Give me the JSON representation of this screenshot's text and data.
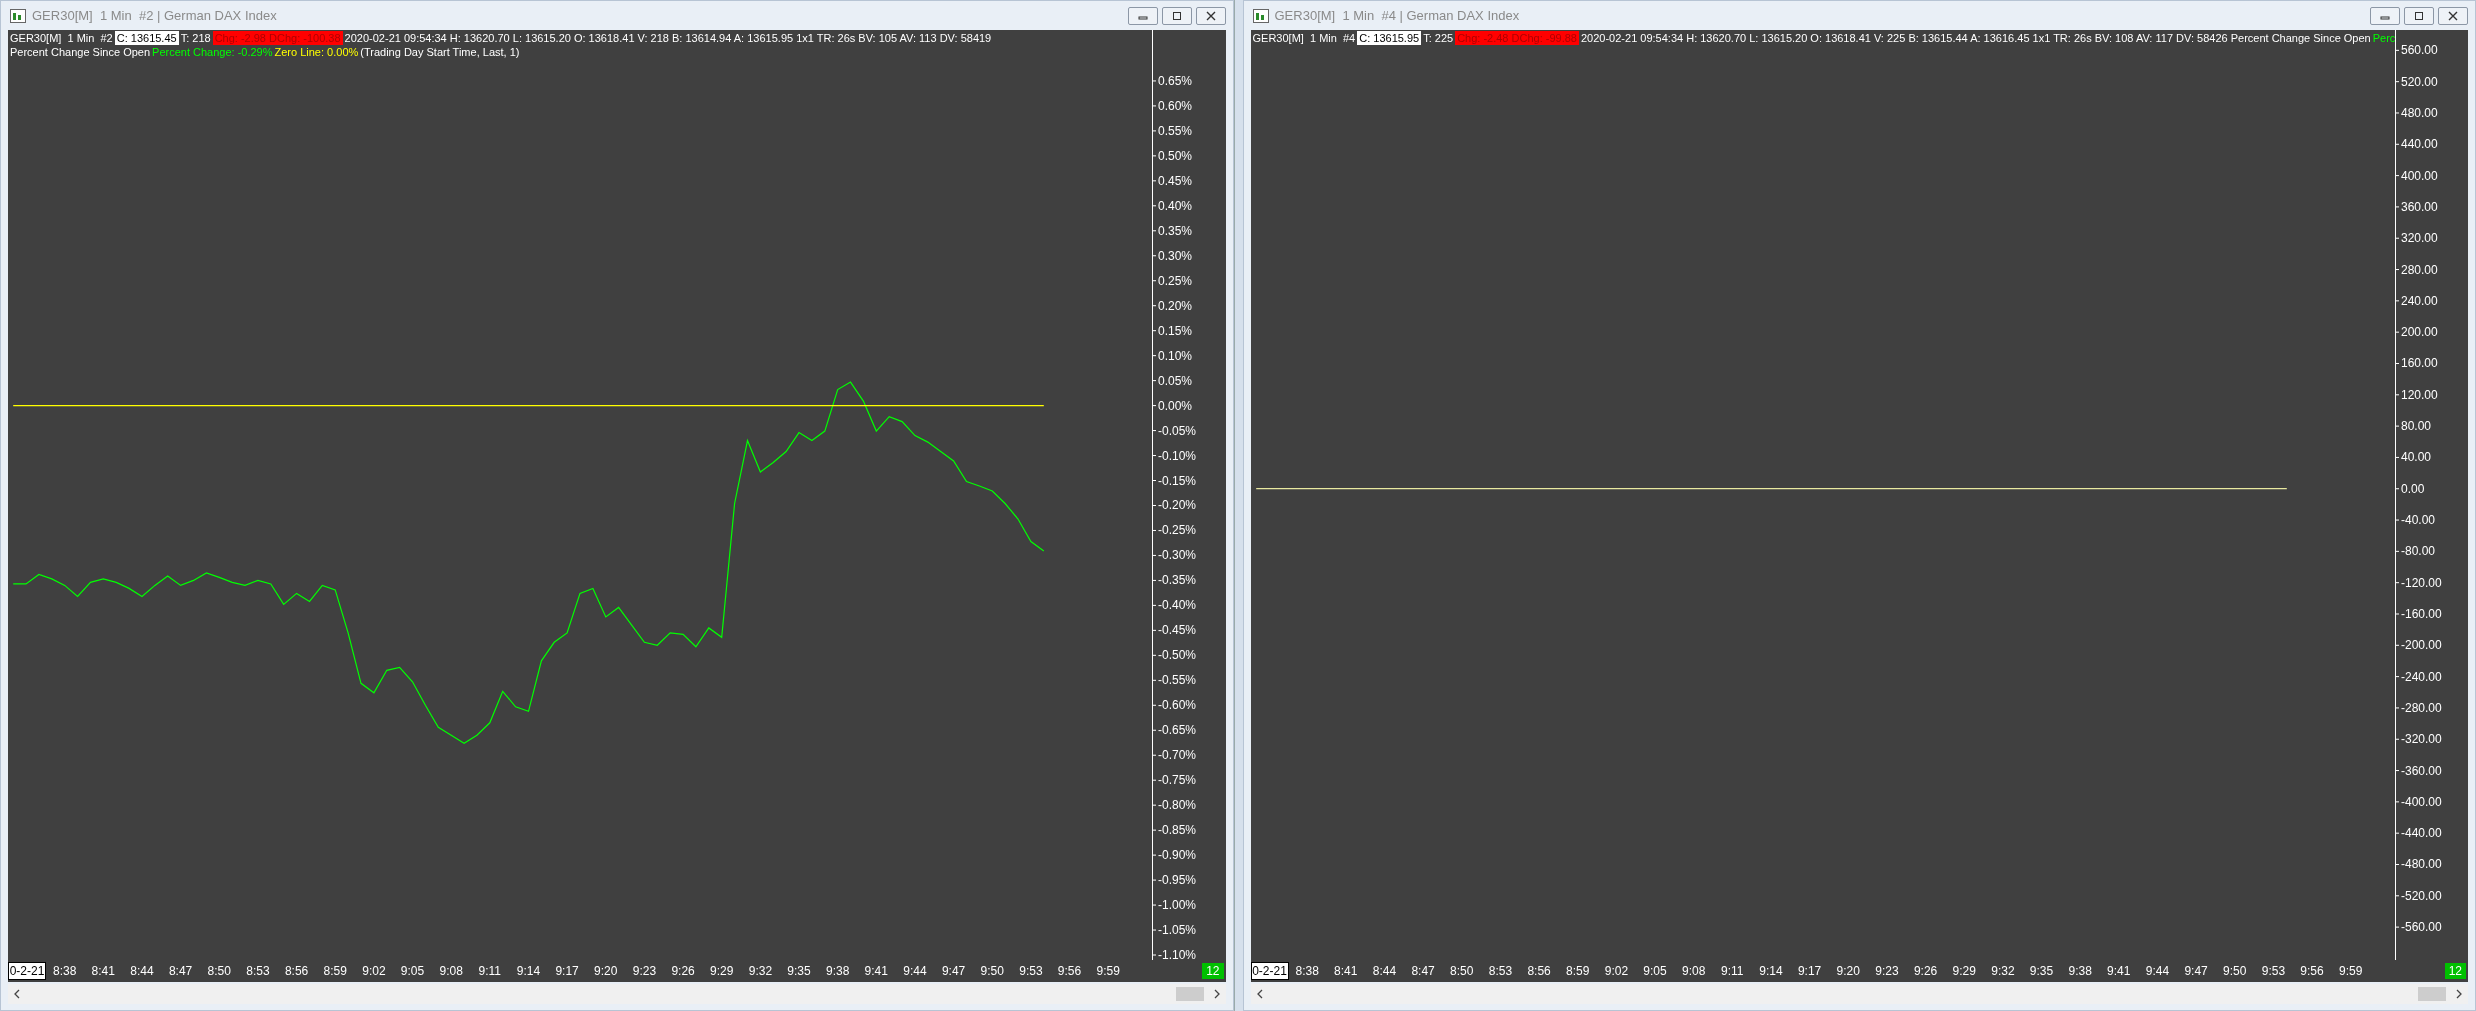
{
  "windows": [
    {
      "title": "GER30[M]  1 Min  #2 | German DAX Index",
      "header_lines": [
        [
          {
            "kind": "text",
            "text": "GER30[M]  1 Min  #2"
          },
          {
            "kind": "boxed",
            "text": "C: 13615.45"
          },
          {
            "kind": "text",
            "text": "T: 218"
          },
          {
            "kind": "alert",
            "text": "Chg: -2.98 DChg: -100.38"
          },
          {
            "kind": "text",
            "text": "2020-02-21 09:54:34 H: 13620.70 L: 13615.20 O: 13618.41 V: 218 B: 13614.94 A: 13615.95 1x1 TR: 26s BV: 105 AV: 113 DV: 58419"
          }
        ],
        [
          {
            "kind": "text",
            "text": "Percent Change Since Open",
            "color": "#ffffff"
          },
          {
            "kind": "text",
            "text": "Percent Change: -0.29%",
            "color": "#00ff00"
          },
          {
            "kind": "text",
            "text": "Zero Line: 0.00%",
            "color": "#ffff00"
          },
          {
            "kind": "text",
            "text": "(Trading Day Start Time, Last, 1)",
            "color": "#ffffff"
          }
        ]
      ],
      "chart_data": {
        "type": "line",
        "categories": [
          null,
          null,
          null,
          null,
          "8:38",
          null,
          null,
          "8:41",
          null,
          null,
          "8:44",
          null,
          null,
          "8:47",
          null,
          null,
          "8:50",
          null,
          null,
          "8:53",
          null,
          null,
          "8:56",
          null,
          null,
          "8:59",
          null,
          null,
          "9:02",
          null,
          null,
          "9:05",
          null,
          null,
          "9:08",
          null,
          null,
          "9:11",
          null,
          null,
          "9:14",
          null,
          null,
          "9:17",
          null,
          null,
          "9:20",
          null,
          null,
          "9:23",
          null,
          null,
          "9:26",
          null,
          null,
          "9:29",
          null,
          null,
          "9:32",
          null,
          null,
          "9:35",
          null,
          null,
          "9:38",
          null,
          null,
          "9:41",
          null,
          null,
          "9:44",
          null,
          null,
          "9:47",
          null,
          null,
          "9:50",
          null,
          null,
          "9:53",
          null,
          null,
          "9:56",
          null,
          null,
          "9:59"
        ],
        "series": [
          {
            "color": "#00ff00",
            "values": [
              -0.357,
              -0.357,
              -0.338,
              -0.347,
              -0.36,
              -0.382,
              -0.354,
              -0.347,
              -0.354,
              -0.366,
              -0.382,
              -0.36,
              -0.341,
              -0.36,
              -0.35,
              -0.335,
              -0.344,
              -0.354,
              -0.36,
              -0.35,
              -0.357,
              -0.398,
              -0.376,
              -0.392,
              -0.36,
              -0.369,
              -0.455,
              -0.556,
              -0.575,
              -0.53,
              -0.524,
              -0.553,
              -0.6,
              -0.644,
              -0.66,
              -0.676,
              -0.66,
              -0.635,
              -0.572,
              -0.603,
              -0.612,
              -0.511,
              -0.474,
              -0.455,
              -0.376,
              -0.366,
              -0.423,
              -0.404,
              -0.439,
              -0.474,
              -0.48,
              -0.455,
              -0.458,
              -0.483,
              -0.445,
              -0.464,
              -0.196,
              -0.07,
              -0.133,
              -0.114,
              -0.092,
              -0.054,
              -0.07,
              -0.051,
              0.032,
              0.047,
              0.009,
              -0.051,
              -0.022,
              -0.032,
              -0.06,
              -0.073,
              -0.092,
              -0.111,
              -0.152,
              -0.161,
              -0.171,
              -0.196,
              -0.227,
              -0.272,
              -0.291,
              null,
              null,
              null,
              null,
              null
            ]
          },
          {
            "color": "#ffff00",
            "values": [
              0,
              0,
              0,
              0,
              0,
              0,
              0,
              0,
              0,
              0,
              0,
              0,
              0,
              0,
              0,
              0,
              0,
              0,
              0,
              0,
              0,
              0,
              0,
              0,
              0,
              0,
              0,
              0,
              0,
              0,
              0,
              0,
              0,
              0,
              0,
              0,
              0,
              0,
              0,
              0,
              0,
              0,
              0,
              0,
              0,
              0,
              0,
              0,
              0,
              0,
              0,
              0,
              0,
              0,
              0,
              0,
              0,
              0,
              0,
              0,
              0,
              0,
              0,
              0,
              0,
              0,
              0,
              0,
              0,
              0,
              0,
              0,
              0,
              0,
              0,
              0,
              0,
              0,
              0,
              0,
              0,
              null,
              null,
              null,
              null,
              null
            ]
          }
        ],
        "ylim": [
          -1.11,
          0.752
        ],
        "yticks": [
          {
            "value": 0.65,
            "label": "0.65%"
          },
          {
            "value": 0.6,
            "label": "0.60%"
          },
          {
            "value": 0.55,
            "label": "0.55%"
          },
          {
            "value": 0.5,
            "label": "0.50%"
          },
          {
            "value": 0.45,
            "label": "0.45%"
          },
          {
            "value": 0.4,
            "label": "0.40%"
          },
          {
            "value": 0.35,
            "label": "0.35%"
          },
          {
            "value": 0.3,
            "label": "0.30%"
          },
          {
            "value": 0.25,
            "label": "0.25%"
          },
          {
            "value": 0.2,
            "label": "0.20%"
          },
          {
            "value": 0.15,
            "label": "0.15%"
          },
          {
            "value": 0.1,
            "label": "0.10%"
          },
          {
            "value": 0.05,
            "label": "0.05%"
          },
          {
            "value": 0,
            "label": "0.00%"
          },
          {
            "value": -0.05,
            "label": "-0.05%"
          },
          {
            "value": -0.1,
            "label": "-0.10%"
          },
          {
            "value": -0.15,
            "label": "-0.15%"
          },
          {
            "value": -0.2,
            "label": "-0.20%"
          },
          {
            "value": -0.25,
            "label": "-0.25%"
          },
          {
            "value": -0.3,
            "label": "-0.30%"
          },
          {
            "value": -0.35,
            "label": "-0.35%"
          },
          {
            "value": -0.4,
            "label": "-0.40%"
          },
          {
            "value": -0.45,
            "label": "-0.45%"
          },
          {
            "value": -0.5,
            "label": "-0.50%"
          },
          {
            "value": -0.55,
            "label": "-0.55%"
          },
          {
            "value": -0.6,
            "label": "-0.60%"
          },
          {
            "value": -0.65,
            "label": "-0.65%"
          },
          {
            "value": -0.7,
            "label": "-0.70%"
          },
          {
            "value": -0.75,
            "label": "-0.75%"
          },
          {
            "value": -0.8,
            "label": "-0.80%"
          },
          {
            "value": -0.85,
            "label": "-0.85%"
          },
          {
            "value": -0.9,
            "label": "-0.90%"
          },
          {
            "value": -0.95,
            "label": "-0.95%"
          },
          {
            "value": -1.0,
            "label": "-1.00%"
          },
          {
            "value": -1.05,
            "label": "-1.05%"
          },
          {
            "value": -1.1,
            "label": "-1.10%"
          }
        ]
      },
      "date_label": "0-2-21",
      "bar_count": "12"
    },
    {
      "title": "GER30[M]  1 Min  #4 | German DAX Index",
      "header_lines": [
        [
          {
            "kind": "text",
            "text": "GER30[M]  1 Min  #4"
          },
          {
            "kind": "boxed",
            "text": "C: 13615.95"
          },
          {
            "kind": "text",
            "text": "T: 225"
          },
          {
            "kind": "alert",
            "text": "Chg: -2.48 DChg: -99.88"
          },
          {
            "kind": "text",
            "text": "2020-02-21 09:54:34 H: 13620.70 L: 13615.20 O: 13618.41 V: 225 B: 13615.44 A: 13616.45 1x1 TR: 26s BV: 108 AV: 117 DV: 58426 Percent Change Since Open"
          },
          {
            "kind": "text",
            "text": "Perc",
            "color": "#00ff00"
          }
        ]
      ],
      "chart_data": {
        "type": "line",
        "categories": [
          null,
          null,
          null,
          null,
          "8:38",
          null,
          null,
          "8:41",
          null,
          null,
          "8:44",
          null,
          null,
          "8:47",
          null,
          null,
          "8:50",
          null,
          null,
          "8:53",
          null,
          null,
          "8:56",
          null,
          null,
          "8:59",
          null,
          null,
          "9:02",
          null,
          null,
          "9:05",
          null,
          null,
          "9:08",
          null,
          null,
          "9:11",
          null,
          null,
          "9:14",
          null,
          null,
          "9:17",
          null,
          null,
          "9:20",
          null,
          null,
          "9:23",
          null,
          null,
          "9:26",
          null,
          null,
          "9:29",
          null,
          null,
          "9:32",
          null,
          null,
          "9:35",
          null,
          null,
          "9:38",
          null,
          null,
          "9:41",
          null,
          null,
          "9:44",
          null,
          null,
          "9:47",
          null,
          null,
          "9:50",
          null,
          null,
          "9:53",
          null,
          null,
          "9:56",
          null,
          null,
          "9:59"
        ],
        "series": [
          {
            "color": "#e8e8a0",
            "values": [
              0,
              0,
              0,
              0,
              0,
              0,
              0,
              0,
              0,
              0,
              0,
              0,
              0,
              0,
              0,
              0,
              0,
              0,
              0,
              0,
              0,
              0,
              0,
              0,
              0,
              0,
              0,
              0,
              0,
              0,
              0,
              0,
              0,
              0,
              0,
              0,
              0,
              0,
              0,
              0,
              0,
              0,
              0,
              0,
              0,
              0,
              0,
              0,
              0,
              0,
              0,
              0,
              0,
              0,
              0,
              0,
              0,
              0,
              0,
              0,
              0,
              0,
              0,
              0,
              0,
              0,
              0,
              0,
              0,
              0,
              0,
              0,
              0,
              0,
              0,
              0,
              0,
              0,
              0,
              0,
              0,
              null,
              null,
              null,
              null,
              null
            ]
          }
        ],
        "ylim": [
          -602,
          586
        ],
        "yticks": [
          {
            "value": 560,
            "label": "560.00"
          },
          {
            "value": 520,
            "label": "520.00"
          },
          {
            "value": 480,
            "label": "480.00"
          },
          {
            "value": 440,
            "label": "440.00"
          },
          {
            "value": 400,
            "label": "400.00"
          },
          {
            "value": 360,
            "label": "360.00"
          },
          {
            "value": 320,
            "label": "320.00"
          },
          {
            "value": 280,
            "label": "280.00"
          },
          {
            "value": 240,
            "label": "240.00"
          },
          {
            "value": 200,
            "label": "200.00"
          },
          {
            "value": 160,
            "label": "160.00"
          },
          {
            "value": 120,
            "label": "120.00"
          },
          {
            "value": 80,
            "label": "80.00"
          },
          {
            "value": 40,
            "label": "40.00"
          },
          {
            "value": 0,
            "label": "0.00"
          },
          {
            "value": -40,
            "label": "-40.00"
          },
          {
            "value": -80,
            "label": "-80.00"
          },
          {
            "value": -120,
            "label": "-120.00"
          },
          {
            "value": -160,
            "label": "-160.00"
          },
          {
            "value": -200,
            "label": "-200.00"
          },
          {
            "value": -240,
            "label": "-240.00"
          },
          {
            "value": -280,
            "label": "-280.00"
          },
          {
            "value": -320,
            "label": "-320.00"
          },
          {
            "value": -360,
            "label": "-360.00"
          },
          {
            "value": -400,
            "label": "-400.00"
          },
          {
            "value": -440,
            "label": "-440.00"
          },
          {
            "value": -480,
            "label": "-480.00"
          },
          {
            "value": -520,
            "label": "-520.00"
          },
          {
            "value": -560,
            "label": "-560.00"
          }
        ]
      },
      "date_label": "0-2-21",
      "bar_count": "12"
    }
  ]
}
